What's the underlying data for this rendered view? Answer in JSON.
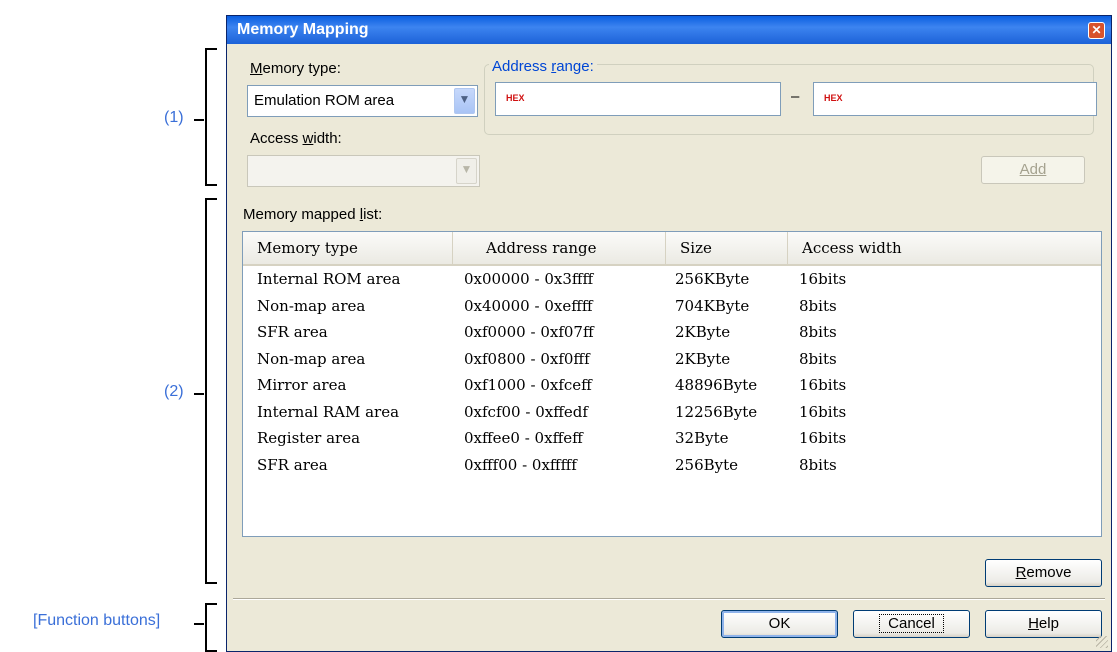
{
  "annotations": {
    "a1": "(1)",
    "a2": "(2)",
    "fn": "[Function buttons]"
  },
  "dialog": {
    "title": "Memory Mapping",
    "close_icon": "close-icon",
    "memory_type_label": "emory type:",
    "memory_type_label_mnemonic": "M",
    "memory_type_value": "Emulation ROM area",
    "address_range_label_pre": "Address ",
    "address_range_label_mnemonic": "r",
    "address_range_label_post": "ange:",
    "hex_tag": "HEX",
    "range_dash": "–",
    "access_width_label_pre": "Access ",
    "access_width_label_mnemonic": "w",
    "access_width_label_post": "idth:",
    "access_width_value": "",
    "add_button": "Add",
    "list_label_pre": "Memory mapped ",
    "list_label_mnemonic": "l",
    "list_label_post": "ist:",
    "columns": [
      "Memory type",
      "Address range",
      "Size",
      "Access width"
    ],
    "rows": [
      [
        "Internal ROM area",
        "0x00000 - 0x3ffff",
        "256KByte",
        "16bits"
      ],
      [
        "Non-map area",
        "0x40000 - 0xeffff",
        "704KByte",
        "8bits"
      ],
      [
        "SFR area",
        "0xf0000 - 0xf07ff",
        "2KByte",
        "8bits"
      ],
      [
        "Non-map area",
        "0xf0800 - 0xf0fff",
        "2KByte",
        "8bits"
      ],
      [
        "Mirror area",
        "0xf1000 - 0xfceff",
        "48896Byte",
        "16bits"
      ],
      [
        "Internal RAM area",
        "0xfcf00 - 0xffedf",
        "12256Byte",
        "16bits"
      ],
      [
        "Register area",
        "0xffee0 - 0xffeff",
        "32Byte",
        "16bits"
      ],
      [
        "SFR area",
        "0xfff00 - 0xfffff",
        "256Byte",
        "8bits"
      ]
    ],
    "remove_button_mnemonic": "R",
    "remove_button_rest": "emove",
    "ok_button": "OK",
    "cancel_button": "Cancel",
    "help_button_mnemonic": "H",
    "help_button_rest": "elp"
  }
}
